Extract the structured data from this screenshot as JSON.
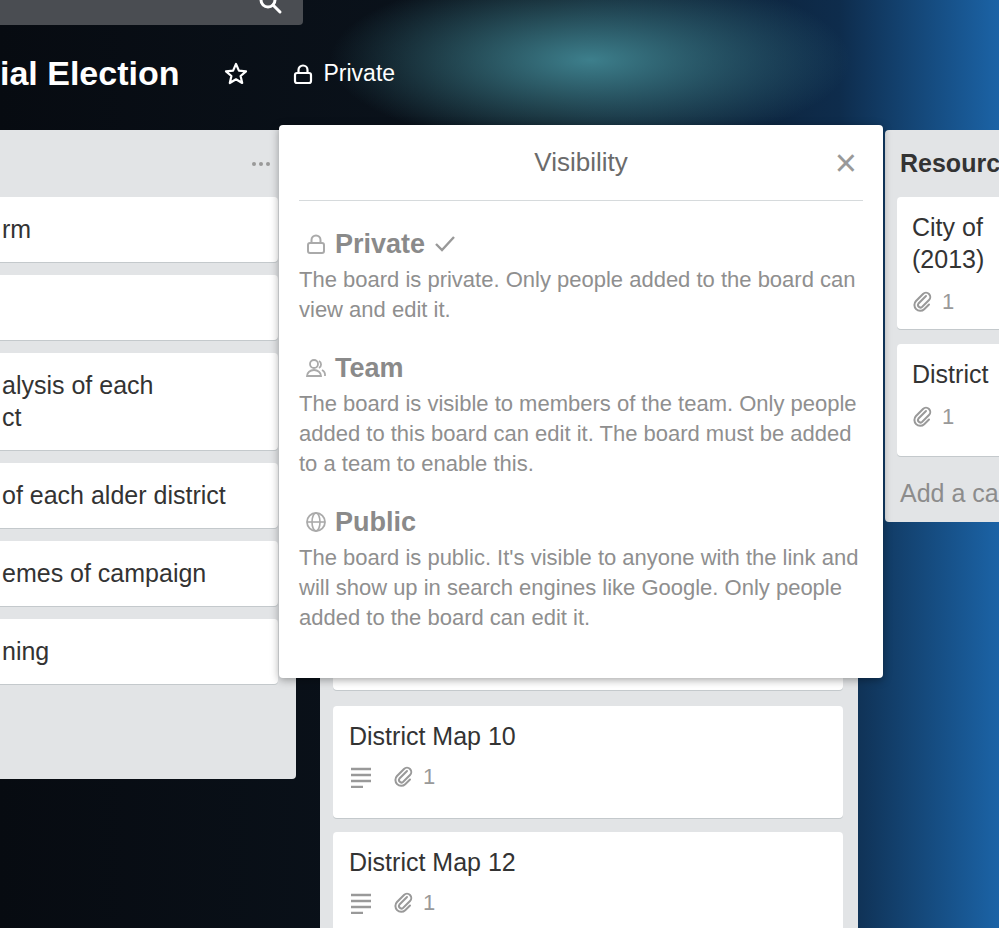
{
  "board": {
    "title": "ial Election",
    "visibility": "Private"
  },
  "left_list": {
    "cards": [
      {
        "text": "rm"
      },
      {
        "text": ""
      },
      {
        "text": "alysis of each\nct"
      },
      {
        "text": "of each alder district"
      },
      {
        "text": "emes of campaign"
      },
      {
        "text": "ning"
      }
    ]
  },
  "middle_list": {
    "cards": [
      {
        "title": "District Map 10",
        "description": true,
        "attachments": "1"
      },
      {
        "title": "District Map 12",
        "description": true,
        "attachments": "1"
      }
    ]
  },
  "right_list": {
    "title": "Resourc",
    "cards": [
      {
        "title": "City of\n(2013)",
        "description": false,
        "attachments": "1"
      },
      {
        "title": "District",
        "description": false,
        "attachments": "1"
      }
    ],
    "add_card": "Add a ca"
  },
  "visibility_popup": {
    "title": "Visibility",
    "close": "×",
    "options": [
      {
        "kind": "private",
        "label": "Private",
        "selected": true,
        "description": "The board is private. Only people added to the board can view and edit it."
      },
      {
        "kind": "team",
        "label": "Team",
        "selected": false,
        "description": "The board is visible to members of the team. Only people added to this board can edit it. The board must be added to a team to enable this."
      },
      {
        "kind": "public",
        "label": "Public",
        "selected": false,
        "description": "The board is public. It's visible to anyone with the link and will show up in search engines like Google. Only people added to the board can edit it."
      }
    ]
  }
}
